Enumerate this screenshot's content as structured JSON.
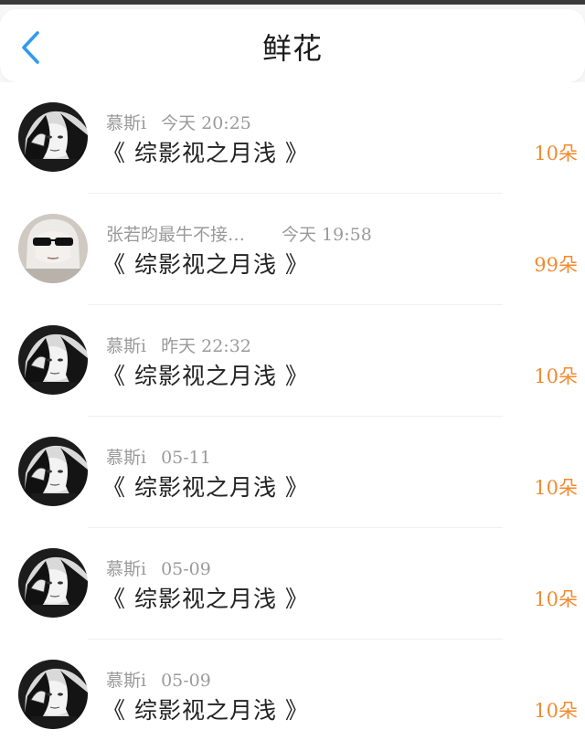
{
  "header": {
    "title": "鲜花",
    "back_icon": "chevron-left-icon",
    "accent_color": "#2f9bef"
  },
  "list": {
    "count_color": "#f28a2e",
    "items": [
      {
        "user": "慕斯i",
        "time": "今天 20:25",
        "book": "《 综影视之月浅 》",
        "count": "10朵",
        "avatar": "dark-hair-portrait"
      },
      {
        "user": "张若昀最牛不接…",
        "time": "今天 19:58",
        "book": "《 综影视之月浅 》",
        "count": "99朵",
        "avatar": "sunglasses-portrait"
      },
      {
        "user": "慕斯i",
        "time": "昨天 22:32",
        "book": "《 综影视之月浅 》",
        "count": "10朵",
        "avatar": "dark-hair-portrait"
      },
      {
        "user": "慕斯i",
        "time": "05-11",
        "book": "《 综影视之月浅 》",
        "count": "10朵",
        "avatar": "dark-hair-portrait"
      },
      {
        "user": "慕斯i",
        "time": "05-09",
        "book": "《 综影视之月浅 》",
        "count": "10朵",
        "avatar": "dark-hair-portrait"
      },
      {
        "user": "慕斯i",
        "time": "05-09",
        "book": "《 综影视之月浅 》",
        "count": "10朵",
        "avatar": "dark-hair-portrait"
      }
    ]
  }
}
